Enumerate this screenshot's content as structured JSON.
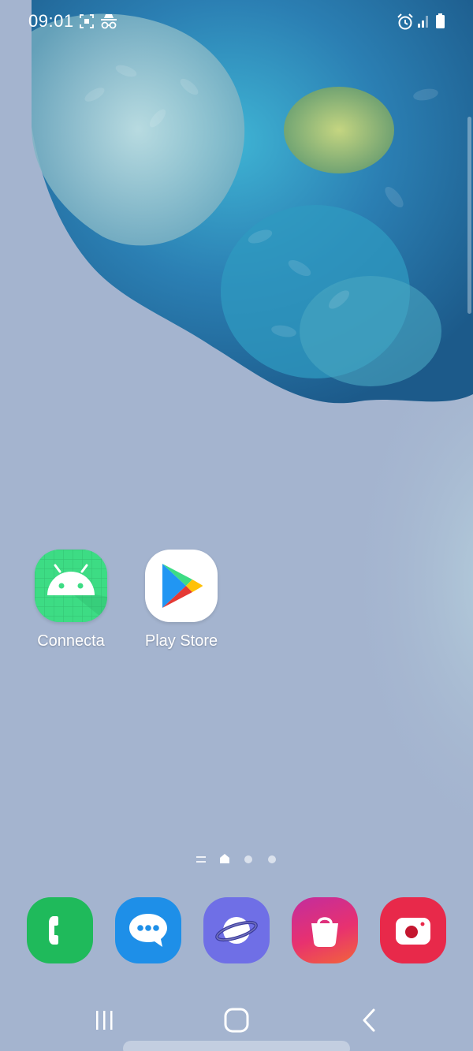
{
  "status_bar": {
    "time": "09:01",
    "left_icons": [
      "screenshot-icon",
      "incognito-icon"
    ],
    "right_icons": [
      "alarm-icon",
      "signal-icon",
      "battery-icon"
    ]
  },
  "home": {
    "apps": [
      {
        "label": "Connecta",
        "icon": "android-icon"
      },
      {
        "label": "Play Store",
        "icon": "play-store-icon"
      }
    ],
    "page_indicator": {
      "items": [
        "apps-list-indicator",
        "home-page-indicator",
        "page-dot",
        "page-dot"
      ],
      "current_page": 1
    }
  },
  "dock": {
    "apps": [
      {
        "icon": "phone-icon",
        "color": "#1fba5b"
      },
      {
        "icon": "messages-icon",
        "color": "#1e8fe8"
      },
      {
        "icon": "internet-icon",
        "color": "#6f6fe6"
      },
      {
        "icon": "galaxy-store-icon",
        "color": "#e2327c"
      },
      {
        "icon": "camera-icon",
        "color": "#e8294a"
      }
    ]
  },
  "nav_bar": {
    "buttons": [
      "recents-icon",
      "home-icon",
      "back-icon"
    ]
  }
}
